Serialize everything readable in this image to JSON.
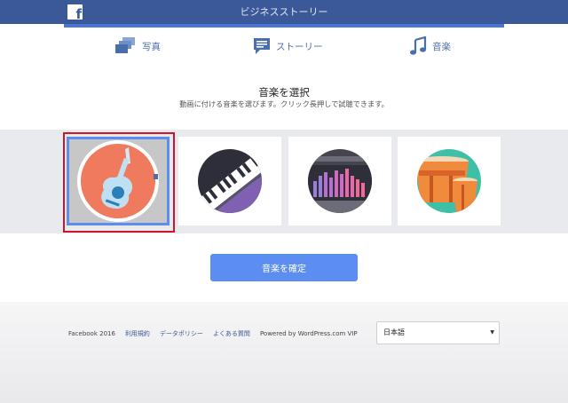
{
  "header": {
    "title": "ビジネスストーリー",
    "logo_letter": "f"
  },
  "tabs": [
    {
      "label": "写真",
      "icon": "photos-icon"
    },
    {
      "label": "ストーリー",
      "icon": "story-icon"
    },
    {
      "label": "音楽",
      "icon": "music-note-icon"
    }
  ],
  "main": {
    "title": "音楽を選択",
    "subtitle": "動画に付ける音楽を選びます。クリック長押しで試聴できます。",
    "music_options": [
      {
        "icon": "guitar-icon",
        "selected": true
      },
      {
        "icon": "keyboard-icon",
        "selected": false
      },
      {
        "icon": "equalizer-icon",
        "selected": false
      },
      {
        "icon": "drums-icon",
        "selected": false
      }
    ],
    "confirm_label": "音楽を確定"
  },
  "footer": {
    "copyright": "Facebook 2016",
    "links": [
      "利用規約",
      "データポリシー",
      "よくある質問"
    ],
    "powered_by": "Powered by WordPress.com VIP",
    "language": {
      "selected": "日本語"
    }
  },
  "colors": {
    "header_bg": "#3b5998",
    "accent_blue": "#5b8ef0",
    "selection_red": "#d0142c",
    "tab_text": "#4a6ea9"
  }
}
